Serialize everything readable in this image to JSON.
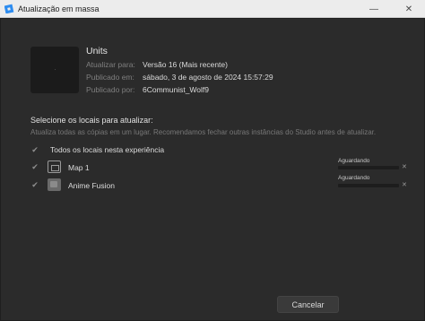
{
  "window": {
    "title": "Atualização em massa",
    "minimize_glyph": "—",
    "close_glyph": "✕"
  },
  "place": {
    "name": "Units",
    "update_to_label": "Atualizar para:",
    "update_to_value": "Versão 16 (Mais recente)",
    "published_at_label": "Publicado em:",
    "published_at_value": "sábado, 3 de agosto de 2024 15:57:29",
    "published_by_label": "Publicado por:",
    "published_by_value": "6Communist_Wolf9"
  },
  "section": {
    "title": "Selecione os locais para atualizar:",
    "description": "Atualiza todas as cópias em um lugar. Recomendamos fechar outras instâncias do Studio antes de atualizar."
  },
  "all_places": {
    "label": "Todos os locais nesta experiência",
    "checked": true
  },
  "places": [
    {
      "name": "Map 1",
      "checked": true,
      "status": "Aguardando",
      "progress": 0,
      "icon": "map-icon"
    },
    {
      "name": "Anime Fusion",
      "checked": true,
      "status": "Aguardando",
      "progress": 0,
      "icon": "place-thumbnail-icon"
    }
  ],
  "checkmark_glyph": "✔",
  "remove_glyph": "✕",
  "cancel_button": "Cancelar",
  "colors": {
    "background": "#2b2b2b",
    "titlebar": "#ececec",
    "progress_fill": "#3d8bf2"
  }
}
